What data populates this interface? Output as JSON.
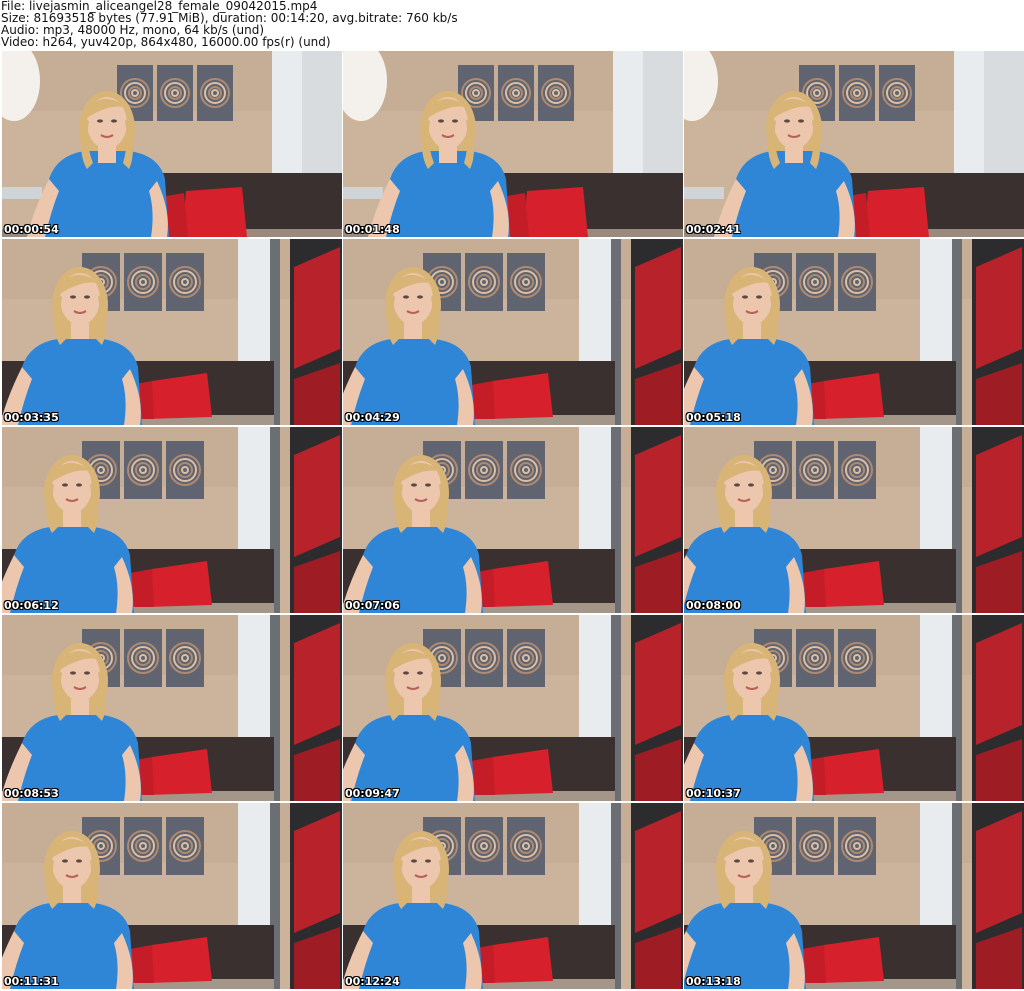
{
  "header": {
    "file": "File: livejasmin_aliceangel28_female_09042015.mp4",
    "size": "Size: 81693518 bytes (77.91 MiB), duration: 00:14:20, avg.bitrate: 760 kb/s",
    "audio": "Audio: mp3, 48000 Hz, mono, 64 kb/s (und)",
    "video": "Video: h264, yuv420p, 864x480, 16000.00 fps(r) (und)"
  },
  "thumbnails": [
    {
      "timestamp": "00:00:54"
    },
    {
      "timestamp": "00:01:48"
    },
    {
      "timestamp": "00:02:41"
    },
    {
      "timestamp": "00:03:35"
    },
    {
      "timestamp": "00:04:29"
    },
    {
      "timestamp": "00:05:18"
    },
    {
      "timestamp": "00:06:12"
    },
    {
      "timestamp": "00:07:06"
    },
    {
      "timestamp": "00:08:00"
    },
    {
      "timestamp": "00:08:53"
    },
    {
      "timestamp": "00:09:47"
    },
    {
      "timestamp": "00:10:37"
    },
    {
      "timestamp": "00:11:31"
    },
    {
      "timestamp": "00:12:24"
    },
    {
      "timestamp": "00:13:18"
    }
  ],
  "colors": {
    "wall": "#cbb49b",
    "shirt": "#2f86d6",
    "pillow": "#d6202b",
    "sofa": "#3a3030",
    "hair": "#d8b477",
    "skin": "#ecc6ad",
    "curtain": "#b8222a"
  }
}
